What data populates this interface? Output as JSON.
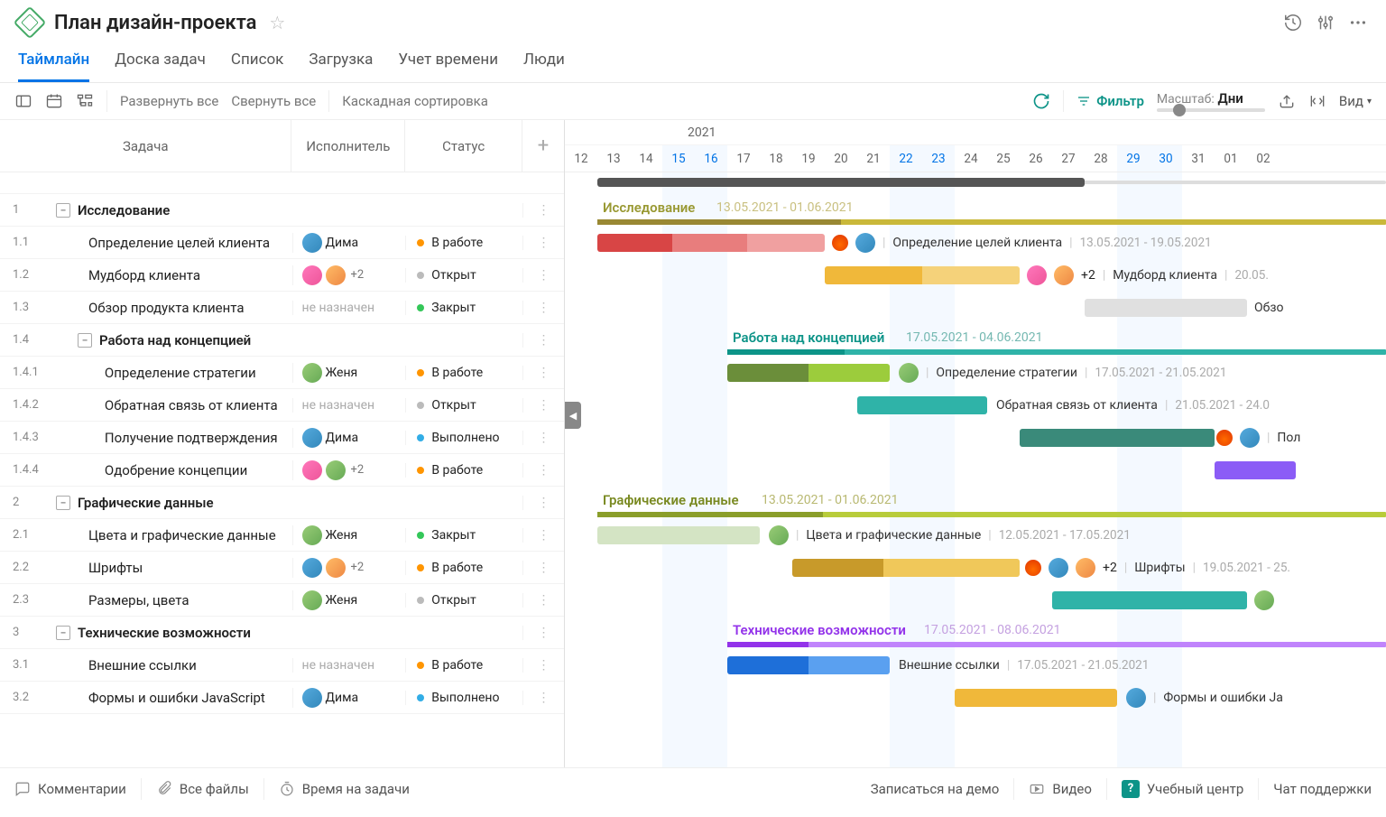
{
  "header": {
    "title": "План дизайн-проекта",
    "icons": {
      "history": "history",
      "settings": "sliders",
      "more": "more"
    }
  },
  "tabs": [
    {
      "label": "Таймлайн",
      "active": true
    },
    {
      "label": "Доска задач"
    },
    {
      "label": "Список"
    },
    {
      "label": "Загрузка"
    },
    {
      "label": "Учет времени"
    },
    {
      "label": "Люди"
    }
  ],
  "toolbar": {
    "expand_all": "Развернуть все",
    "collapse_all": "Свернуть все",
    "cascade_sort": "Каскадная сортировка",
    "filter": "Фильтр",
    "scale_label": "Масштаб:",
    "scale_value": "Дни",
    "view": "Вид"
  },
  "grid_headers": {
    "task": "Задача",
    "assignee": "Исполнитель",
    "status": "Статус"
  },
  "statuses": {
    "in_progress": "В работе",
    "open": "Открыт",
    "closed": "Закрыт",
    "done": "Выполнено"
  },
  "assignees": {
    "dima": "Дима",
    "zhenya": "Женя",
    "unassigned": "не назначен",
    "plus2": "+2"
  },
  "year": "2021",
  "days": [
    12,
    13,
    14,
    15,
    16,
    17,
    18,
    19,
    20,
    21,
    22,
    23,
    24,
    25,
    26,
    27,
    28,
    29,
    30,
    31,
    "01",
    "02"
  ],
  "weekends": [
    15,
    16,
    22,
    23,
    29,
    30
  ],
  "gantt": {
    "g1": {
      "title": "Исследование",
      "dates": "13.05.2021 - 01.06.2021",
      "color": "#999933"
    },
    "g2": {
      "title": "Работа над концепцией",
      "dates": "17.05.2021 - 04.06.2021",
      "color": "#0d9488"
    },
    "g3": {
      "title": "Графические данные",
      "dates": "13.05.2021 - 01.06.2021",
      "color": "#a0af22"
    },
    "g4": {
      "title": "Технические возможности",
      "dates": "17.05.2021 - 08.06.2021",
      "color": "#9333ea"
    }
  },
  "tasks": {
    "t11": {
      "name": "Определение целей клиента",
      "dates": "13.05.2021 - 19.05.2021"
    },
    "t12": {
      "name": "Мудборд клиента",
      "dates": "20.05."
    },
    "t13": {
      "name": "Обзор продукта клиента",
      "short": "Обзо"
    },
    "t141": {
      "name": "Определение стратегии",
      "dates": "17.05.2021 - 21.05.2021"
    },
    "t142": {
      "name": "Обратная связь от клиента",
      "dates": "21.05.2021 - 24.0"
    },
    "t143": {
      "name": "Получение подтверждения",
      "short": "Пол"
    },
    "t144": {
      "name": "Одобрение концепции"
    },
    "t21": {
      "name": "Цвета и графические данные",
      "dates": "12.05.2021 - 17.05.2021"
    },
    "t22": {
      "name": "Шрифты",
      "dates": "19.05.2021 - 25."
    },
    "t23": {
      "name": "Размеры, цвета"
    },
    "t31": {
      "name": "Внешние ссылки",
      "dates": "17.05.2021 - 21.05.2021"
    },
    "t32": {
      "name": "Формы и ошибки JavaScript",
      "short": "Формы и ошибки Ja"
    }
  },
  "rows": [
    {
      "num": "1",
      "name": "Исследование",
      "bold": true,
      "indent": 0,
      "collapse": true
    },
    {
      "num": "1.1",
      "name": "Определение целей клиента",
      "indent": 1,
      "assignee": "dima",
      "av": [
        "av-2"
      ],
      "status": "in_progress"
    },
    {
      "num": "1.2",
      "name": "Мудборд клиента",
      "indent": 1,
      "av": [
        "av-1",
        "av-3"
      ],
      "more": true,
      "status": "open"
    },
    {
      "num": "1.3",
      "name": "Обзор продукта клиента",
      "indent": 1,
      "assignee": "unassigned",
      "status": "closed"
    },
    {
      "num": "1.4",
      "name": "Работа над концепцией",
      "bold": true,
      "indent": 1,
      "collapse": true,
      "indent_class": "indent-0",
      "pad": 34
    },
    {
      "num": "1.4.1",
      "name": "Определение стратегии",
      "indent": 2,
      "assignee": "zhenya",
      "av": [
        "av-4"
      ],
      "status": "in_progress"
    },
    {
      "num": "1.4.2",
      "name": "Обратная связь от клиента",
      "indent": 2,
      "assignee": "unassigned",
      "status": "open"
    },
    {
      "num": "1.4.3",
      "name": "Получение подтверждения",
      "indent": 2,
      "assignee": "dima",
      "av": [
        "av-2"
      ],
      "status": "done"
    },
    {
      "num": "1.4.4",
      "name": "Одобрение концепции",
      "indent": 2,
      "av": [
        "av-1",
        "av-4"
      ],
      "more": true,
      "status": "in_progress"
    },
    {
      "num": "2",
      "name": "Графические данные",
      "bold": true,
      "indent": 0,
      "collapse": true
    },
    {
      "num": "2.1",
      "name": "Цвета и графические данные",
      "indent": 1,
      "assignee": "zhenya",
      "av": [
        "av-4"
      ],
      "status": "closed"
    },
    {
      "num": "2.2",
      "name": "Шрифты",
      "indent": 1,
      "av": [
        "av-2",
        "av-3"
      ],
      "more": true,
      "status": "in_progress"
    },
    {
      "num": "2.3",
      "name": "Размеры, цвета",
      "indent": 1,
      "assignee": "zhenya",
      "av": [
        "av-4"
      ],
      "status": "open"
    },
    {
      "num": "3",
      "name": "Технические возможности",
      "bold": true,
      "indent": 0,
      "collapse": true
    },
    {
      "num": "3.1",
      "name": "Внешние ссылки",
      "indent": 1,
      "assignee": "unassigned",
      "status": "in_progress"
    },
    {
      "num": "3.2",
      "name": "Формы и ошибки JavaScript",
      "indent": 1,
      "assignee": "dima",
      "av": [
        "av-2"
      ],
      "status": "done"
    }
  ],
  "footer": {
    "comments": "Комментарии",
    "files": "Все файлы",
    "time": "Время на задачи",
    "demo": "Записаться на демо",
    "video": "Видео",
    "learning": "Учебный центр",
    "support": "Чат поддержки"
  }
}
